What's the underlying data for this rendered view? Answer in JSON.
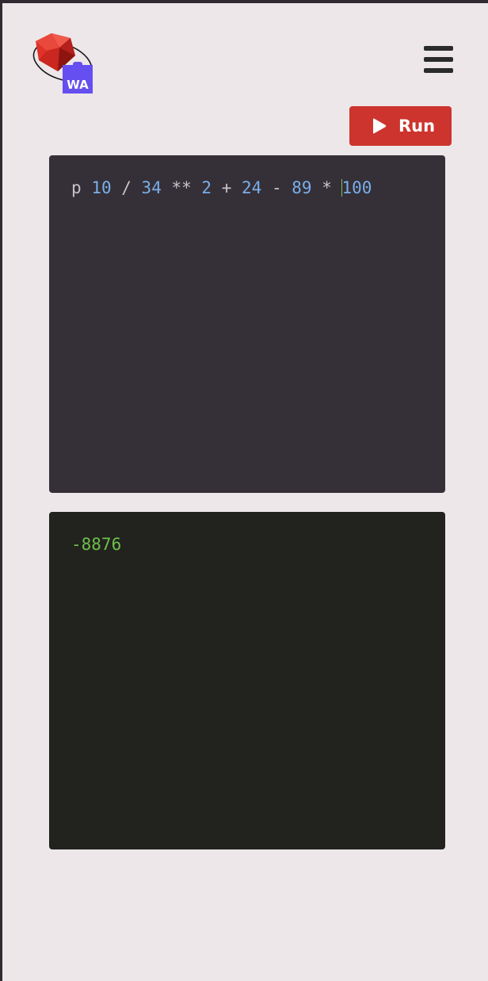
{
  "header": {
    "logo_badge": "WA",
    "menu_icon": "hamburger-menu-icon"
  },
  "toolbar": {
    "run_label": "Run",
    "run_icon": "play-icon"
  },
  "editor": {
    "tokens": [
      {
        "text": "p",
        "type": "kw"
      },
      {
        "text": " ",
        "type": "op"
      },
      {
        "text": "10",
        "type": "num"
      },
      {
        "text": " / ",
        "type": "op"
      },
      {
        "text": "34",
        "type": "num"
      },
      {
        "text": " ** ",
        "type": "op"
      },
      {
        "text": "2",
        "type": "num"
      },
      {
        "text": " + ",
        "type": "op"
      },
      {
        "text": "24",
        "type": "num"
      },
      {
        "text": " - ",
        "type": "op"
      },
      {
        "text": "89",
        "type": "num"
      },
      {
        "text": " * ",
        "type": "op"
      },
      {
        "text": "100",
        "type": "num"
      }
    ]
  },
  "output": {
    "text": "-8876"
  },
  "colors": {
    "background": "#ede7e9",
    "run_button": "#cc342d",
    "editor_bg": "#353037",
    "output_bg": "#22221e",
    "output_text": "#6cc04a",
    "number": "#7aaeea",
    "logo_badge": "#654ff0"
  }
}
